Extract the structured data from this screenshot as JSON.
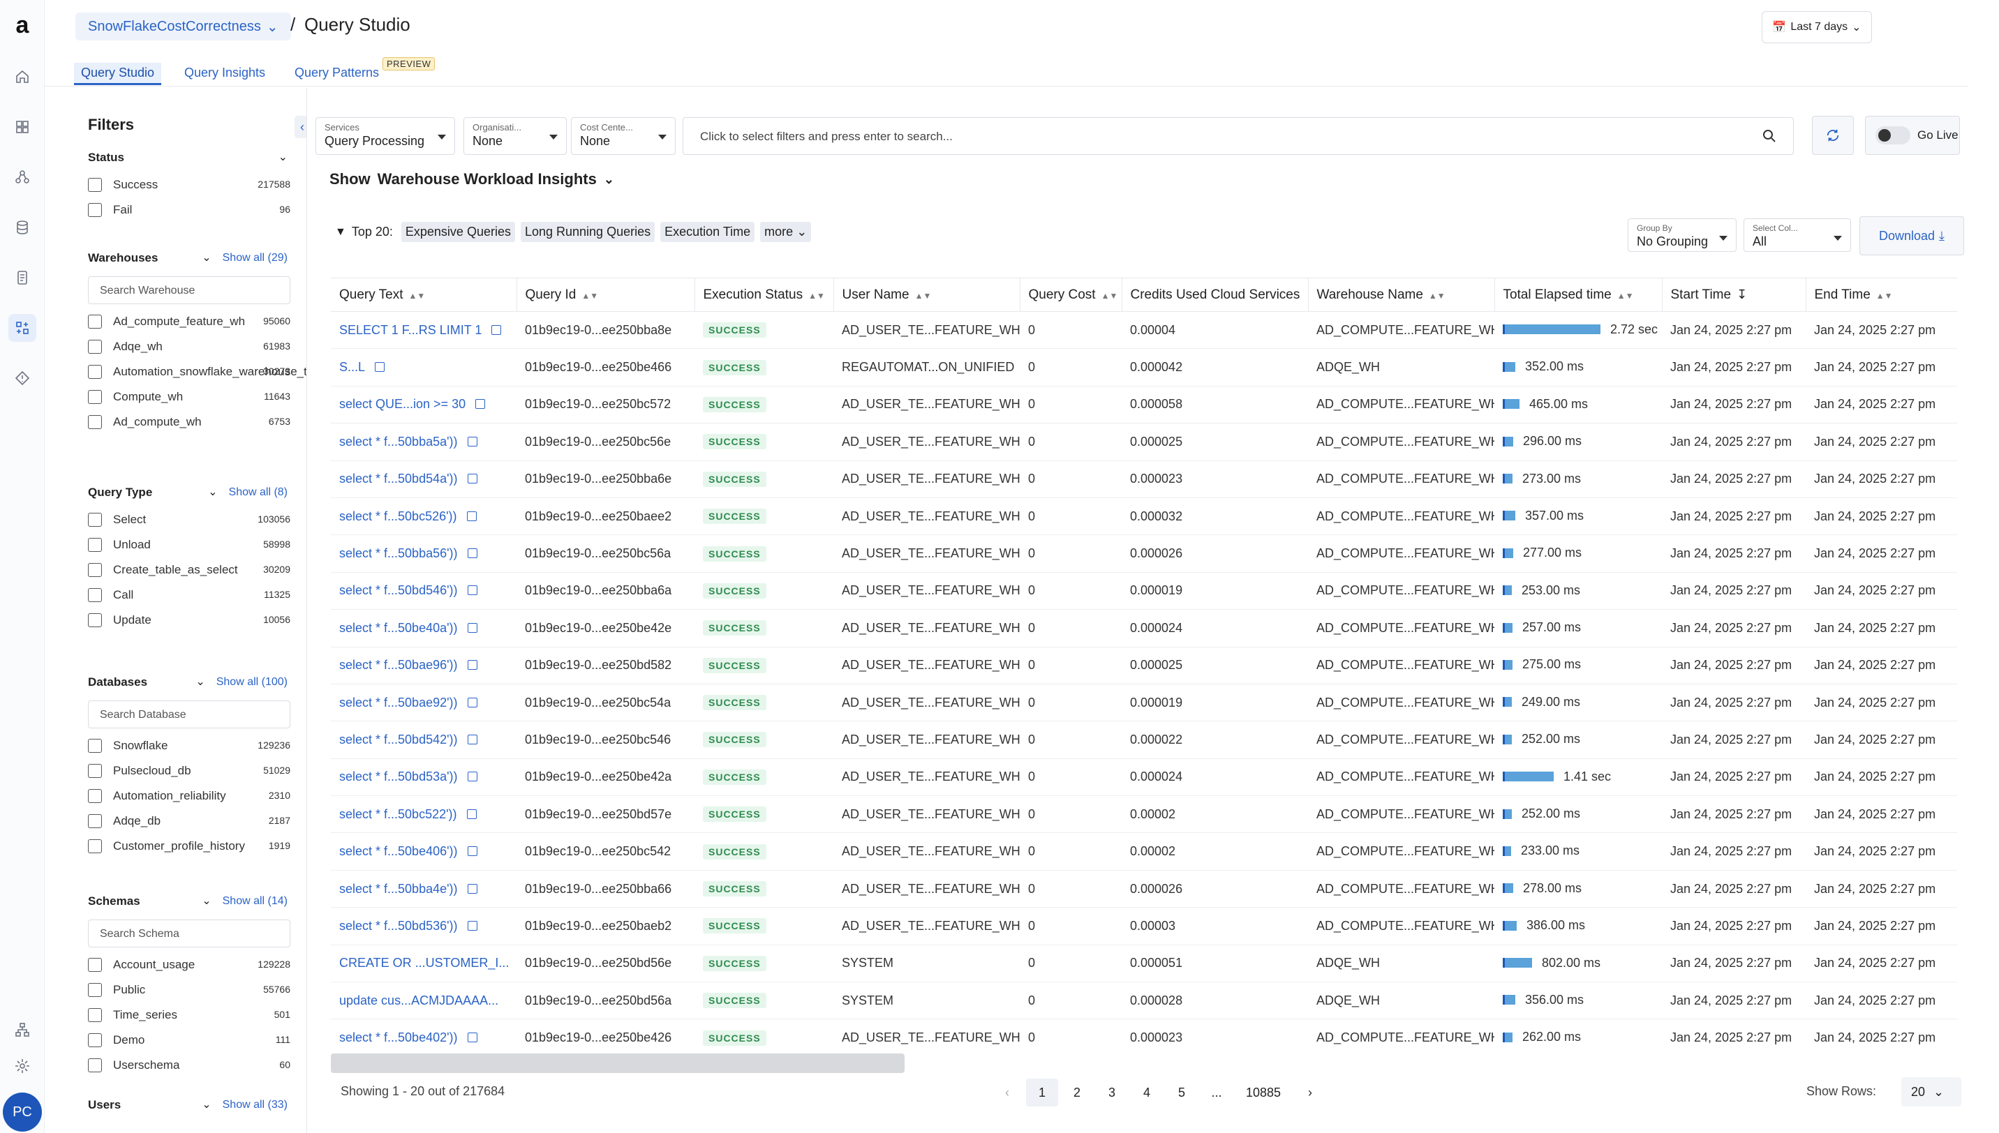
{
  "header": {
    "project": "SnowFlakeCostCorrectness",
    "separator": "/",
    "title": "Query Studio",
    "date_range": "Last 7 days"
  },
  "tabs": [
    {
      "label": "Query Studio"
    },
    {
      "label": "Query Insights"
    },
    {
      "label": "Query Patterns"
    }
  ],
  "preview_badge": "PREVIEW",
  "user": {
    "initials": "PC"
  },
  "filters": {
    "title": "Filters",
    "status": {
      "title": "Status",
      "items": [
        {
          "label": "Success",
          "count": "217588"
        },
        {
          "label": "Fail",
          "count": "96"
        }
      ]
    },
    "warehouses": {
      "title": "Warehouses",
      "show_all": "Show all (29)",
      "search": "Search Warehouse",
      "items": [
        {
          "label": "Ad_compute_feature_wh",
          "count": "95060"
        },
        {
          "label": "Adqe_wh",
          "count": "61983"
        },
        {
          "label": "Automation_snowflake_warehouse_torch",
          "count": "30273"
        },
        {
          "label": "Compute_wh",
          "count": "11643"
        },
        {
          "label": "Ad_compute_wh",
          "count": "6753"
        }
      ]
    },
    "query_type": {
      "title": "Query Type",
      "show_all": "Show all (8)",
      "items": [
        {
          "label": "Select",
          "count": "103056"
        },
        {
          "label": "Unload",
          "count": "58998"
        },
        {
          "label": "Create_table_as_select",
          "count": "30209"
        },
        {
          "label": "Call",
          "count": "11325"
        },
        {
          "label": "Update",
          "count": "10056"
        }
      ]
    },
    "databases": {
      "title": "Databases",
      "show_all": "Show all (100)",
      "search": "Search Database",
      "items": [
        {
          "label": "Snowflake",
          "count": "129236"
        },
        {
          "label": "Pulsecloud_db",
          "count": "51029"
        },
        {
          "label": "Automation_reliability",
          "count": "2310"
        },
        {
          "label": "Adqe_db",
          "count": "2187"
        },
        {
          "label": "Customer_profile_history",
          "count": "1919"
        }
      ]
    },
    "schemas": {
      "title": "Schemas",
      "show_all": "Show all (14)",
      "search": "Search Schema",
      "items": [
        {
          "label": "Account_usage",
          "count": "129228"
        },
        {
          "label": "Public",
          "count": "55766"
        },
        {
          "label": "Time_series",
          "count": "501"
        },
        {
          "label": "Demo",
          "count": "111"
        },
        {
          "label": "Userschema",
          "count": "60"
        }
      ]
    },
    "users": {
      "title": "Users",
      "show_all": "Show all (33)"
    }
  },
  "toolbar": {
    "services_label": "Services",
    "services_value": "Query Processing",
    "org_label": "Organisati...",
    "org_value": "None",
    "cost_label": "Cost Cente...",
    "cost_value": "None",
    "search_placeholder": "Click to select filters and press enter to search...",
    "go_live": "Go Live"
  },
  "show": {
    "prefix": "Show",
    "value": "Warehouse Workload Insights"
  },
  "top": {
    "label": "Top 20:",
    "chips": [
      "Expensive Queries",
      "Long Running Queries",
      "Execution Time"
    ],
    "more": "more"
  },
  "group_by": {
    "label": "Group By",
    "value": "No Grouping"
  },
  "select_col": {
    "label": "Select Col...",
    "value": "All"
  },
  "download": "Download",
  "columns": [
    "Query Text",
    "Query Id",
    "Execution Status",
    "User Name",
    "Query Cost",
    "Credits Used Cloud Services",
    "Warehouse Name",
    "Total Elapsed time",
    "Start Time",
    "End Time"
  ],
  "rows": [
    {
      "q": "SELECT 1 F...RS LIMIT 1",
      "id": "01b9ec19-0...ee250bba8e",
      "st": "SUCCESS",
      "user": "AD_USER_TE...FEATURE_WH",
      "cost": "0",
      "credits": "0.00004",
      "wh": "AD_COMPUTE...FEATURE_WH",
      "elapsed": "2.72 sec",
      "frac": 0.26,
      "start": "Jan 24, 2025 2:27 pm",
      "end": "Jan 24, 2025 2:27 pm"
    },
    {
      "q": "S...L",
      "id": "01b9ec19-0...ee250be466",
      "st": "SUCCESS",
      "user": "REGAUTOMAT...ON_UNIFIED",
      "cost": "0",
      "credits": "0.000042",
      "wh": "ADQE_WH",
      "elapsed": "352.00 ms",
      "frac": 0.034,
      "start": "Jan 24, 2025 2:27 pm",
      "end": "Jan 24, 2025 2:27 pm"
    },
    {
      "q": "select QUE...ion >= 30",
      "id": "01b9ec19-0...ee250bc572",
      "st": "SUCCESS",
      "user": "AD_USER_TE...FEATURE_WH",
      "cost": "0",
      "credits": "0.000058",
      "wh": "AD_COMPUTE...FEATURE_WH",
      "elapsed": "465.00 ms",
      "frac": 0.045,
      "start": "Jan 24, 2025 2:27 pm",
      "end": "Jan 24, 2025 2:27 pm"
    },
    {
      "q": "select * f...50bba5a'))",
      "id": "01b9ec19-0...ee250bc56e",
      "st": "SUCCESS",
      "user": "AD_USER_TE...FEATURE_WH",
      "cost": "0",
      "credits": "0.000025",
      "wh": "AD_COMPUTE...FEATURE_WH",
      "elapsed": "296.00 ms",
      "frac": 0.028,
      "start": "Jan 24, 2025 2:27 pm",
      "end": "Jan 24, 2025 2:27 pm"
    },
    {
      "q": "select * f...50bd54a'))",
      "id": "01b9ec19-0...ee250bba6e",
      "st": "SUCCESS",
      "user": "AD_USER_TE...FEATURE_WH",
      "cost": "0",
      "credits": "0.000023",
      "wh": "AD_COMPUTE...FEATURE_WH",
      "elapsed": "273.00 ms",
      "frac": 0.026,
      "start": "Jan 24, 2025 2:27 pm",
      "end": "Jan 24, 2025 2:27 pm"
    },
    {
      "q": "select * f...50bc526'))",
      "id": "01b9ec19-0...ee250baee2",
      "st": "SUCCESS",
      "user": "AD_USER_TE...FEATURE_WH",
      "cost": "0",
      "credits": "0.000032",
      "wh": "AD_COMPUTE...FEATURE_WH",
      "elapsed": "357.00 ms",
      "frac": 0.034,
      "start": "Jan 24, 2025 2:27 pm",
      "end": "Jan 24, 2025 2:27 pm"
    },
    {
      "q": "select * f...50bba56'))",
      "id": "01b9ec19-0...ee250bc56a",
      "st": "SUCCESS",
      "user": "AD_USER_TE...FEATURE_WH",
      "cost": "0",
      "credits": "0.000026",
      "wh": "AD_COMPUTE...FEATURE_WH",
      "elapsed": "277.00 ms",
      "frac": 0.027,
      "start": "Jan 24, 2025 2:27 pm",
      "end": "Jan 24, 2025 2:27 pm"
    },
    {
      "q": "select * f...50bd546'))",
      "id": "01b9ec19-0...ee250bba6a",
      "st": "SUCCESS",
      "user": "AD_USER_TE...FEATURE_WH",
      "cost": "0",
      "credits": "0.000019",
      "wh": "AD_COMPUTE...FEATURE_WH",
      "elapsed": "253.00 ms",
      "frac": 0.024,
      "start": "Jan 24, 2025 2:27 pm",
      "end": "Jan 24, 2025 2:27 pm"
    },
    {
      "q": "select * f...50be40a'))",
      "id": "01b9ec19-0...ee250be42e",
      "st": "SUCCESS",
      "user": "AD_USER_TE...FEATURE_WH",
      "cost": "0",
      "credits": "0.000024",
      "wh": "AD_COMPUTE...FEATURE_WH",
      "elapsed": "257.00 ms",
      "frac": 0.025,
      "start": "Jan 24, 2025 2:27 pm",
      "end": "Jan 24, 2025 2:27 pm"
    },
    {
      "q": "select * f...50bae96'))",
      "id": "01b9ec19-0...ee250bd582",
      "st": "SUCCESS",
      "user": "AD_USER_TE...FEATURE_WH",
      "cost": "0",
      "credits": "0.000025",
      "wh": "AD_COMPUTE...FEATURE_WH",
      "elapsed": "275.00 ms",
      "frac": 0.026,
      "start": "Jan 24, 2025 2:27 pm",
      "end": "Jan 24, 2025 2:27 pm"
    },
    {
      "q": "select * f...50bae92'))",
      "id": "01b9ec19-0...ee250bc54a",
      "st": "SUCCESS",
      "user": "AD_USER_TE...FEATURE_WH",
      "cost": "0",
      "credits": "0.000019",
      "wh": "AD_COMPUTE...FEATURE_WH",
      "elapsed": "249.00 ms",
      "frac": 0.024,
      "start": "Jan 24, 2025 2:27 pm",
      "end": "Jan 24, 2025 2:27 pm"
    },
    {
      "q": "select * f...50bd542'))",
      "id": "01b9ec19-0...ee250bc546",
      "st": "SUCCESS",
      "user": "AD_USER_TE...FEATURE_WH",
      "cost": "0",
      "credits": "0.000022",
      "wh": "AD_COMPUTE...FEATURE_WH",
      "elapsed": "252.00 ms",
      "frac": 0.024,
      "start": "Jan 24, 2025 2:27 pm",
      "end": "Jan 24, 2025 2:27 pm"
    },
    {
      "q": "select * f...50bd53a'))",
      "id": "01b9ec19-0...ee250be42a",
      "st": "SUCCESS",
      "user": "AD_USER_TE...FEATURE_WH",
      "cost": "0",
      "credits": "0.000024",
      "wh": "AD_COMPUTE...FEATURE_WH",
      "elapsed": "1.41 sec",
      "frac": 0.135,
      "start": "Jan 24, 2025 2:27 pm",
      "end": "Jan 24, 2025 2:27 pm"
    },
    {
      "q": "select * f...50bc522'))",
      "id": "01b9ec19-0...ee250bd57e",
      "st": "SUCCESS",
      "user": "AD_USER_TE...FEATURE_WH",
      "cost": "0",
      "credits": "0.00002",
      "wh": "AD_COMPUTE...FEATURE_WH",
      "elapsed": "252.00 ms",
      "frac": 0.024,
      "start": "Jan 24, 2025 2:27 pm",
      "end": "Jan 24, 2025 2:27 pm"
    },
    {
      "q": "select * f...50be406'))",
      "id": "01b9ec19-0...ee250bc542",
      "st": "SUCCESS",
      "user": "AD_USER_TE...FEATURE_WH",
      "cost": "0",
      "credits": "0.00002",
      "wh": "AD_COMPUTE...FEATURE_WH",
      "elapsed": "233.00 ms",
      "frac": 0.022,
      "start": "Jan 24, 2025 2:27 pm",
      "end": "Jan 24, 2025 2:27 pm"
    },
    {
      "q": "select * f...50bba4e'))",
      "id": "01b9ec19-0...ee250bba66",
      "st": "SUCCESS",
      "user": "AD_USER_TE...FEATURE_WH",
      "cost": "0",
      "credits": "0.000026",
      "wh": "AD_COMPUTE...FEATURE_WH",
      "elapsed": "278.00 ms",
      "frac": 0.027,
      "start": "Jan 24, 2025 2:27 pm",
      "end": "Jan 24, 2025 2:27 pm"
    },
    {
      "q": "select * f...50bd536'))",
      "id": "01b9ec19-0...ee250baeb2",
      "st": "SUCCESS",
      "user": "AD_USER_TE...FEATURE_WH",
      "cost": "0",
      "credits": "0.00003",
      "wh": "AD_COMPUTE...FEATURE_WH",
      "elapsed": "386.00 ms",
      "frac": 0.037,
      "start": "Jan 24, 2025 2:27 pm",
      "end": "Jan 24, 2025 2:27 pm"
    },
    {
      "q": "CREATE OR ...USTOMER_I...",
      "id": "01b9ec19-0...ee250bd56e",
      "st": "SUCCESS",
      "user": "SYSTEM",
      "cost": "0",
      "credits": "0.000051",
      "wh": "ADQE_WH",
      "elapsed": "802.00 ms",
      "frac": 0.077,
      "start": "Jan 24, 2025 2:27 pm",
      "end": "Jan 24, 2025 2:27 pm"
    },
    {
      "q": "update cus...ACMJDAAAA...",
      "id": "01b9ec19-0...ee250bd56a",
      "st": "SUCCESS",
      "user": "SYSTEM",
      "cost": "0",
      "credits": "0.000028",
      "wh": "ADQE_WH",
      "elapsed": "356.00 ms",
      "frac": 0.034,
      "start": "Jan 24, 2025 2:27 pm",
      "end": "Jan 24, 2025 2:27 pm"
    },
    {
      "q": "select * f...50be402'))",
      "id": "01b9ec19-0...ee250be426",
      "st": "SUCCESS",
      "user": "AD_USER_TE...FEATURE_WH",
      "cost": "0",
      "credits": "0.000023",
      "wh": "AD_COMPUTE...FEATURE_WH",
      "elapsed": "262.00 ms",
      "frac": 0.025,
      "start": "Jan 24, 2025 2:27 pm",
      "end": "Jan 24, 2025 2:27 pm"
    }
  ],
  "footer": {
    "showing": "Showing 1 - 20 out of 217684",
    "pages": [
      "1",
      "2",
      "3",
      "4",
      "5",
      "...",
      "10885"
    ],
    "show_rows_label": "Show Rows:",
    "show_rows_value": "20"
  }
}
